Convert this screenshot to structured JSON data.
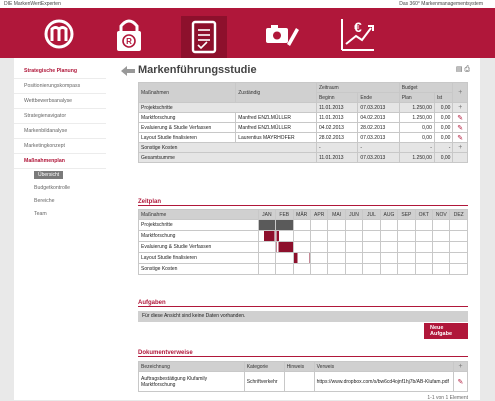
{
  "topbar": {
    "left": "DIE MarkenWertExperten",
    "right": "Das 360° Markenmanagementsystem"
  },
  "header": {
    "icons": [
      "logo-m-icon",
      "trademark-lock-icon",
      "tablet-checklist-icon",
      "camera-pen-icon",
      "euro-chart-icon"
    ],
    "active_index": 2
  },
  "colors": {
    "brand": "#b0173a",
    "brand_dark": "#8d102c"
  },
  "sidebar": {
    "items": [
      {
        "label": "Strategische Planung",
        "style": "red"
      },
      {
        "label": "Positionierungskompass",
        "style": ""
      },
      {
        "label": "Wettbewerbsanalyse",
        "style": ""
      },
      {
        "label": "Strategienavigator",
        "style": ""
      },
      {
        "label": "Markenbildanalyse",
        "style": ""
      },
      {
        "label": "Marketingkonzept",
        "style": ""
      },
      {
        "label": "Maßnahmenplan",
        "style": "red"
      },
      {
        "label": "Übersicht",
        "style": "chip"
      },
      {
        "label": "Budgetkontrolle",
        "style": "sub"
      },
      {
        "label": "Bereiche",
        "style": "sub"
      },
      {
        "label": "Team",
        "style": "sub"
      }
    ]
  },
  "main": {
    "title": "Markenführungsstudie",
    "table": {
      "h_massnahmen": "Maßnahmen",
      "h_zustaendig": "Zuständig",
      "h_zeitraum": "Zeitraum",
      "h_budget": "Budget",
      "h_beginn": "Beginn",
      "h_ende": "Ende",
      "h_plan": "Plan",
      "h_ist": "Ist",
      "project_label": "Projektschritte",
      "project_beginn": "11.01.2013",
      "project_ende": "07.03.2013",
      "project_plan": "1.250,00",
      "project_ist": "0,00",
      "rows": [
        {
          "m": "Marktforschung",
          "z": "Manfred ENZLMÜLLER",
          "b": "11.01.2013",
          "e": "04.02.2013",
          "p": "1.250,00",
          "i": "0,00"
        },
        {
          "m": "Evaluierung & Studie Verfassen",
          "z": "Manfred ENZLMÜLLER",
          "b": "04.02.2013",
          "e": "28.02.2013",
          "p": "0,00",
          "i": "0,00"
        },
        {
          "m": "Layout Studie finalisieren",
          "z": "Laurentius MAYRHOFER",
          "b": "28.02.2013",
          "e": "07.03.2013",
          "p": "0,00",
          "i": "0,00"
        }
      ],
      "sonstige_label": "Sonstige Kosten",
      "sonstige_beginn": "-",
      "sonstige_ende": "-",
      "sonstige_plan": "-",
      "sonstige_ist": "-",
      "gesamt_label": "Gesamtsumme",
      "gesamt_beginn": "11.01.2013",
      "gesamt_ende": "07.03.2013",
      "gesamt_plan": "1.250,00",
      "gesamt_ist": "0,00"
    },
    "zeitplan": {
      "title": "Zeitplan",
      "h_massnahme": "Maßnahme",
      "months": [
        "JAN",
        "FEB",
        "MÄR",
        "APR",
        "MAI",
        "JUN",
        "JUL",
        "AUG",
        "SEP",
        "OKT",
        "NOV",
        "DEZ"
      ],
      "rows": [
        {
          "label": "Projektschritte",
          "bars": [
            [
              0,
              "dark"
            ],
            [
              1,
              "dark"
            ]
          ]
        },
        {
          "label": "Marktforschung",
          "bars": [
            [
              0,
              "red"
            ],
            [
              1,
              "red-partial"
            ]
          ]
        },
        {
          "label": "Evaluierung & Studie Verfassen",
          "bars": [
            [
              1,
              "red"
            ]
          ]
        },
        {
          "label": "Layout Studie finalisieren",
          "bars": [
            [
              2,
              "red-thin"
            ]
          ]
        },
        {
          "label": "Sonstige Kosten",
          "bars": []
        }
      ]
    },
    "aufgaben": {
      "title": "Aufgaben",
      "empty": "Für diese Ansicht sind keine Daten vorhanden.",
      "button": "Neue Aufgabe"
    },
    "dokumente": {
      "title": "Dokumentverweise",
      "h_bezeichnung": "Bezeichnung",
      "h_kategorie": "Kategorie",
      "h_hinweis": "Hinweis",
      "h_verweis": "Verweis",
      "row_bez": "Auftragsbestätigung Klufamily Marktforschung",
      "row_kat": "Schriftverkehr",
      "row_hin": "",
      "row_ver": "https://www.dropbox.com/s/bw6cd4ojnf1hj7b/AB-Klufam.pdf",
      "footer": "1-1 von 1 Element"
    }
  }
}
